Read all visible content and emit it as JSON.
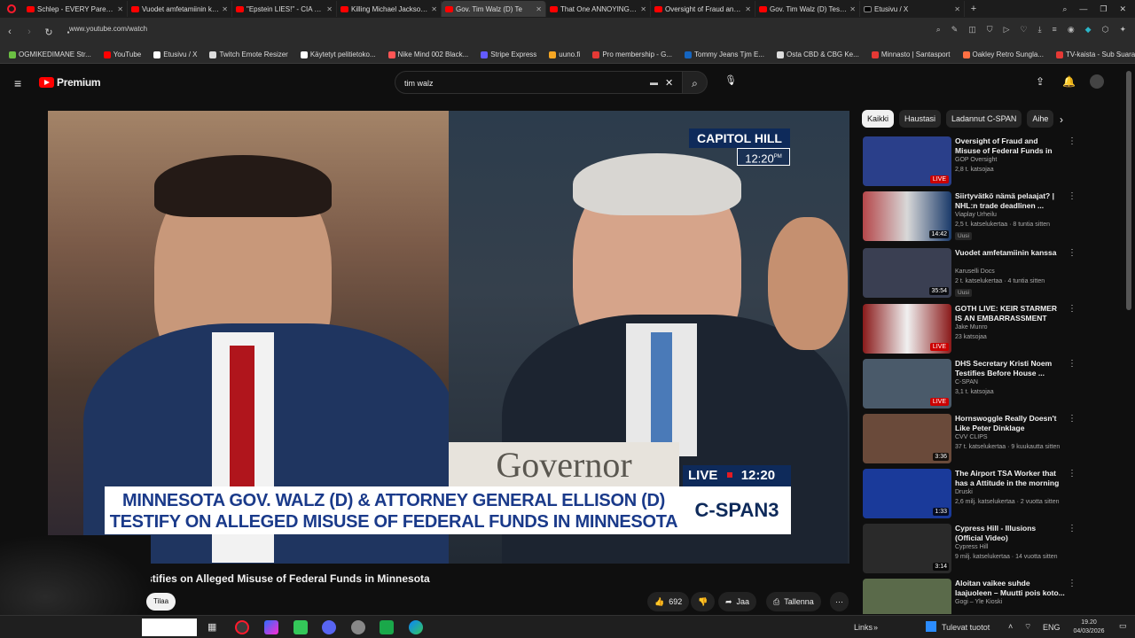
{
  "browser": {
    "tabs": [
      {
        "label": "Schlep - EVERY Parent Ne",
        "active": false
      },
      {
        "label": "Vuodet amfetamiinin kan",
        "active": false
      },
      {
        "label": "\"Epstein LIES!\" - CIA John",
        "active": false
      },
      {
        "label": "Killing Michael Jackson: Tr",
        "active": false
      },
      {
        "label": "Gov. Tim Walz (D) Te",
        "active": true
      },
      {
        "label": "That One ANNOYING Dru",
        "active": false
      },
      {
        "label": "Oversight of Fraud and M",
        "active": false
      },
      {
        "label": "Gov. Tim Walz (D) Testifie",
        "active": false
      },
      {
        "label": "Etusivu / X",
        "active": false
      }
    ],
    "url": "www.youtube.com/watch",
    "bookmarks": [
      {
        "label": "OGMIKEDIMANE Str...",
        "color": "#6bc043"
      },
      {
        "label": "YouTube",
        "color": "#ff0000"
      },
      {
        "label": "Etusivu / X",
        "color": "#ffffff"
      },
      {
        "label": "Twitch Emote Resizer",
        "color": "#dddddd"
      },
      {
        "label": "Käytetyt pelitietoko...",
        "color": "#ffffff"
      },
      {
        "label": "Nike Mind 002 Black...",
        "color": "#ff5555"
      },
      {
        "label": "Stripe Express",
        "color": "#635bff"
      },
      {
        "label": "uuno.fi",
        "color": "#f5a623"
      },
      {
        "label": "Pro membership - G...",
        "color": "#e53935"
      },
      {
        "label": "Tommy Jeans Tjm E...",
        "color": "#1565c0"
      },
      {
        "label": "Osta CBD & CBG Ke...",
        "color": "#dddddd"
      },
      {
        "label": "Minnasto | Santasport",
        "color": "#e53935"
      },
      {
        "label": "Oakley Retro Sungla...",
        "color": "#ff7043"
      },
      {
        "label": "TV-kaista - Sub Suara",
        "color": "#e53935"
      }
    ]
  },
  "youtube": {
    "logo_text": "Premium",
    "search_value": "tim walz",
    "video": {
      "capitol_label": "CAPITOL HILL",
      "capitol_time": "12:20",
      "chyron_line1": "MINNESOTA GOV. WALZ (D) & ATTORNEY GENERAL ELLISON (D)",
      "chyron_line2": "TESTIFY ON ALLEGED MISUSE OF FEDERAL FUNDS IN MINNESOTA",
      "live_label": "LIVE",
      "live_time": "12:20",
      "network": "C-SPAN3",
      "placard": "Governor"
    },
    "title": "D) Testifies on Alleged Misuse of Federal Funds in Minnesota",
    "subscribe_label": "Tilaa",
    "likes": "692",
    "share_label": "Jaa",
    "save_label": "Tallenna",
    "chips": [
      "Kaikki",
      "Haustasi",
      "Ladannut C-SPAN",
      "Aihe"
    ],
    "sidebar": [
      {
        "title": "Oversight of Fraud and Misuse of Federal Funds in Minnesota...",
        "channel": "GOP Oversight",
        "meta": "2,8 t. katsojaa",
        "badge": "LIVE",
        "thumb_color": "#2a3f8a"
      },
      {
        "title": "Siirtyvätkö nämä pelaajat? | NHL:n trade deadlinen ...",
        "channel": "Viaplay Urheilu",
        "meta": "2,5 t. katselukertaa · 8 tuntia sitten",
        "badge": "14:42",
        "new": "Uusi",
        "thumb_color": "#b5474a"
      },
      {
        "title": "Vuodet amfetamiinin kanssa",
        "channel": "Karuselli Docs",
        "meta": "2 t. katselukertaa · 4 tuntia sitten",
        "badge": "35:54",
        "new": "Uusi",
        "thumb_color": "#3a3f52"
      },
      {
        "title": "GOTH LIVE: KEIR STARMER IS AN EMBARRASSMENT",
        "channel": "Jake Munro",
        "meta": "23 katsojaa",
        "badge": "LIVE",
        "thumb_color": "#8a1a1a"
      },
      {
        "title": "DHS Secretary Kristi Noem Testifies Before House ...",
        "channel": "C-SPAN",
        "meta": "3,1 t. katsojaa",
        "badge": "LIVE",
        "thumb_color": "#4a5a6a"
      },
      {
        "title": "Hornswoggle Really Doesn't Like Peter Dinklage",
        "channel": "CVV CLIPS",
        "meta": "37 t. katselukertaa · 9 kuukautta sitten",
        "badge": "3:36",
        "thumb_color": "#6a4a3a"
      },
      {
        "title": "The Airport TSA Worker that has a Attitude in the morning",
        "channel": "Druski",
        "meta": "2,6 milj. katselukertaa · 2 vuotta sitten",
        "badge": "1:33",
        "thumb_color": "#1a3a9a"
      },
      {
        "title": "Cypress Hill - Illusions (Official Video)",
        "channel": "Cypress Hill",
        "meta": "9 milj. katselukertaa · 14 vuotta sitten",
        "badge": "3:14",
        "thumb_color": "#2a2a2a"
      },
      {
        "title": "Aloitan vaikee suhde laajuoleen – Muutti pois koto...",
        "channel": "Gogi – Yle Kioski",
        "meta": "",
        "badge": "",
        "thumb_color": "#5a6a4a"
      }
    ]
  },
  "taskbar": {
    "links_label": "Links",
    "weather": "Tulevat tuotot",
    "lang": "ENG",
    "time": "19.20",
    "date": "04/03/2026"
  }
}
